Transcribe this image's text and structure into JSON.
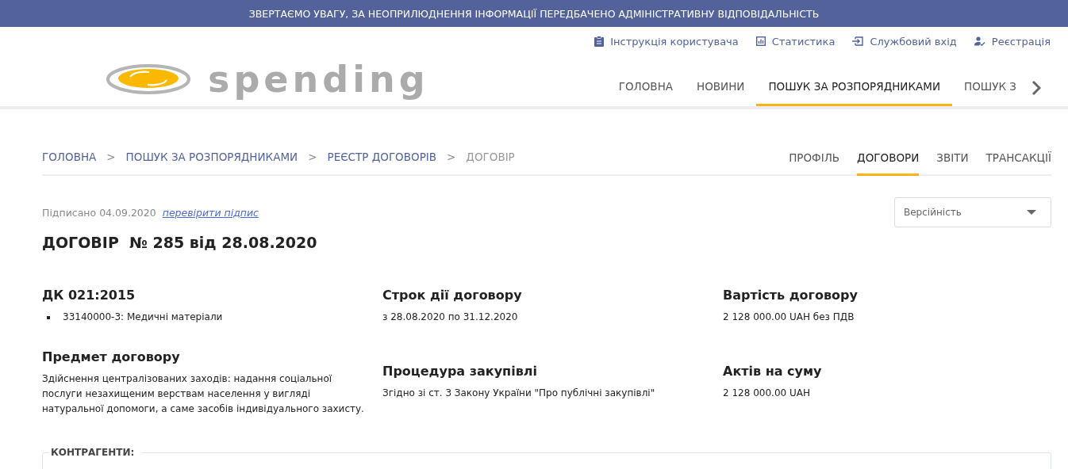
{
  "notice": "ЗВЕРТАЄМО УВАГУ, ЗА НЕОПРИЛЮДНЕННЯ ІНФОРМАЦІЇ ПЕРЕДБАЧЕНО АДМІНІСТРАТИВНУ ВІДПОВІДАЛЬНІСТЬ",
  "top_links": [
    {
      "label": "Інструкція користувача",
      "kind": "manual"
    },
    {
      "label": "Статистика",
      "kind": "stats"
    },
    {
      "label": "Службовий вхід",
      "kind": "login"
    },
    {
      "label": "Реєстрація",
      "kind": "register"
    }
  ],
  "logo": {
    "wordmark": "spending"
  },
  "nav": [
    {
      "label": "ГОЛОВНА",
      "selected": false
    },
    {
      "label": "НОВИНИ",
      "selected": false
    },
    {
      "label": "ПОШУК ЗА РОЗПОРЯДНИКАМИ",
      "selected": true
    },
    {
      "label": "ПОШУК З",
      "selected": false
    }
  ],
  "breadcrumbs": [
    {
      "label": "ГОЛОВНА",
      "current": false
    },
    {
      "label": "ПОШУК ЗА РОЗПОРЯДНИКАМИ",
      "current": false
    },
    {
      "label": "РЕЄСТР ДОГОВОРІВ",
      "current": false
    },
    {
      "label": "ДОГОВІР",
      "current": true
    }
  ],
  "breadcrumb_separator": ">",
  "tabs": [
    {
      "label": "ПРОФІЛЬ",
      "selected": false
    },
    {
      "label": "ДОГОВОРИ",
      "selected": true
    },
    {
      "label": "ЗВІТИ",
      "selected": false
    },
    {
      "label": "ТРАНСАКЦІЇ",
      "selected": false
    }
  ],
  "signed": {
    "text": "Підписано 04.09.2020",
    "link": "перевірити підпис"
  },
  "version_select": {
    "placeholder": "Версійність"
  },
  "title": "ДОГОВІР  № 285 від 28.08.2020",
  "columns": [
    {
      "blocks": [
        {
          "kind": "list",
          "heading": "ДК 021:2015",
          "items": [
            "33140000-3: Медичні матеріали"
          ]
        },
        {
          "kind": "text",
          "heading": "Предмет договору",
          "text": "Здійснення централізованих заходів: надання соціальної послуги незахищеним верствам населення у вигляді натуральної допомоги, а саме засобів індивідуального захисту."
        }
      ]
    },
    {
      "blocks": [
        {
          "kind": "text",
          "heading": "Строк дії договору",
          "text": "з 28.08.2020 по 31.12.2020"
        },
        {
          "kind": "text",
          "heading": "Процедура закупівлі",
          "text": "Згідно зі ст. 3 Закону України \"Про публічні закупівлі\""
        }
      ]
    },
    {
      "blocks": [
        {
          "kind": "text",
          "heading": "Вартість договору",
          "text": "2 128 000.00 UAH без ПДВ"
        },
        {
          "kind": "text",
          "heading": "Актів на суму",
          "text": "2 128 000.00 UAH"
        }
      ]
    }
  ],
  "contractors": {
    "legend": "КОНТРАГЕНТИ:"
  }
}
